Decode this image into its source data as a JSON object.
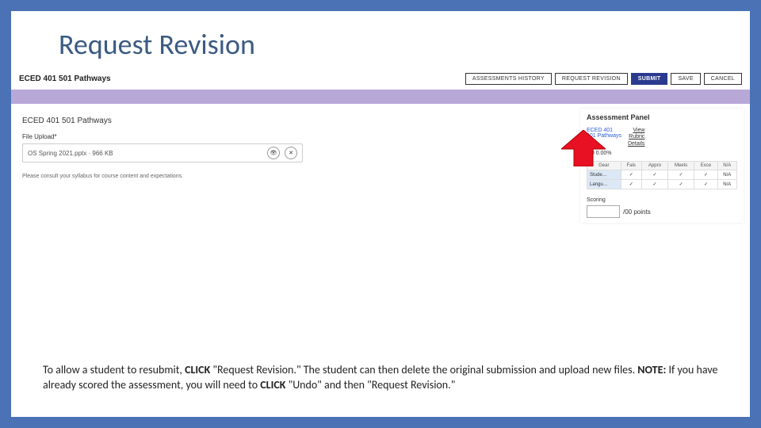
{
  "slide": {
    "title": "Request Revision"
  },
  "app": {
    "course_title": "ECED 401 501 Pathways",
    "buttons": {
      "assessments_history": "ASSESSMENTS HISTORY",
      "request_revision": "REQUEST REVISION",
      "submit": "SUBMIT",
      "save": "SAVE",
      "cancel": "CANCEL"
    },
    "main": {
      "heading": "ECED 401 501 Pathways",
      "file_upload_label": "File Upload*",
      "file_name": "OS Spring 2021.pptx · 966 KB",
      "view_icon": "👁",
      "delete_icon": "✕",
      "hint": "Please consult your syllabus for course content and expectations."
    },
    "panel": {
      "title": "Assessment Panel",
      "course_code": "ECED 401",
      "course_sub": "501 Pathways",
      "link_view": "View",
      "link_rubric": "Rubric",
      "link_details": "Details",
      "score_line": "0/0   0.00%",
      "headers": [
        "Gear",
        "Fals",
        "Appro",
        "Meets",
        "Exce",
        "N/A"
      ],
      "rows": [
        {
          "label": "Stude…",
          "cells": [
            "✓",
            "✓",
            "✓",
            "✓",
            "N/A"
          ]
        },
        {
          "label": "Langu…",
          "cells": [
            "✓",
            "✓",
            "✓",
            "✓",
            "N/A"
          ]
        }
      ],
      "scoring_label": "Scoring",
      "scoring_suffix": "/00 points"
    }
  },
  "caption": {
    "t1": "To allow a student to resubmit, ",
    "b1": "CLICK",
    "t2": " \"Request Revision.\"  The student can then delete the original submission and upload new files. ",
    "b2": "NOTE:",
    "t3": " If you have already scored the assessment, you will need to ",
    "b3": "CLICK",
    "t4": " \"Undo\" and then \"Request Revision.\""
  }
}
